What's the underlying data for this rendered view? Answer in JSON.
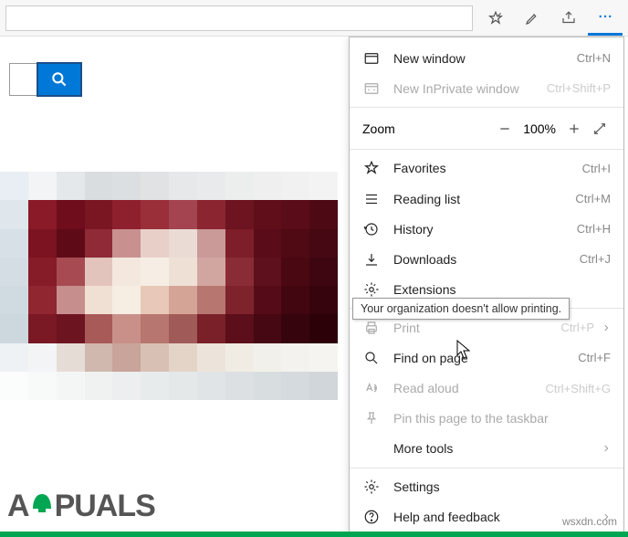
{
  "toolbar": {
    "address_value": ""
  },
  "search": {
    "value": ""
  },
  "menu": {
    "new_window": {
      "label": "New window",
      "shortcut": "Ctrl+N"
    },
    "new_inprivate": {
      "label": "New InPrivate window",
      "shortcut": "Ctrl+Shift+P"
    },
    "zoom": {
      "label": "Zoom",
      "percent": "100%"
    },
    "favorites": {
      "label": "Favorites",
      "shortcut": "Ctrl+I"
    },
    "reading_list": {
      "label": "Reading list",
      "shortcut": "Ctrl+M"
    },
    "history": {
      "label": "History",
      "shortcut": "Ctrl+H"
    },
    "downloads": {
      "label": "Downloads",
      "shortcut": "Ctrl+J"
    },
    "extensions": {
      "label": "Extensions"
    },
    "print": {
      "label": "Print",
      "shortcut": "Ctrl+P"
    },
    "find": {
      "label": "Find on page",
      "shortcut": "Ctrl+F"
    },
    "read_aloud": {
      "label": "Read aloud",
      "shortcut": "Ctrl+Shift+G"
    },
    "pin": {
      "label": "Pin this page to the taskbar"
    },
    "more_tools": {
      "label": "More tools"
    },
    "settings": {
      "label": "Settings"
    },
    "help": {
      "label": "Help and feedback"
    }
  },
  "tooltip": {
    "print_disabled": "Your organization doesn't allow printing."
  },
  "watermark": {
    "brand": "A PUALS",
    "url": "wsxdn.com"
  },
  "colors": {
    "accent": "#0078d7",
    "green": "#00a651"
  }
}
